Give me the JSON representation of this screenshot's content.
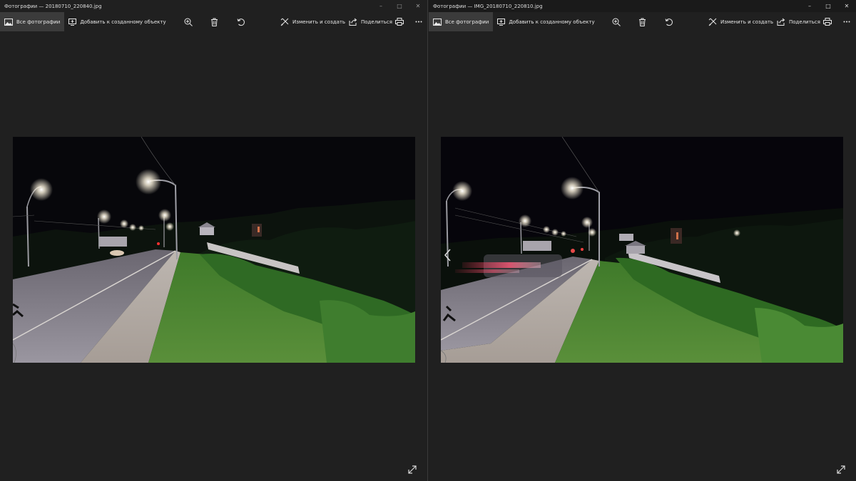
{
  "windows": [
    {
      "title": "Фотографии — 20180710_220840.jpg",
      "toolbar": {
        "all_photos": "Все фотографии",
        "add_to_creation": "Добавить к созданному объекту",
        "edit_create": "Изменить и создать",
        "share": "Поделиться"
      }
    },
    {
      "title": "Фотографии — IMG_20180710_220810.jpg",
      "toolbar": {
        "all_photos": "Все фотографии",
        "add_to_creation": "Добавить к созданному объекту",
        "edit_create": "Изменить и создать",
        "share": "Поделиться"
      }
    }
  ],
  "icons": {
    "minimize": "minimize-icon",
    "maximize": "maximize-icon",
    "close": "close-icon",
    "photos": "photos-icon",
    "add": "add-to-creation-icon",
    "zoom": "zoom-in-icon",
    "delete": "trash-icon",
    "rotate": "rotate-icon",
    "edit": "edit-create-icon",
    "share": "share-icon",
    "print": "print-icon",
    "more": "more-icon",
    "expand": "expand-icon",
    "prev": "chevron-left-icon"
  },
  "colors": {
    "background": "#202020",
    "active_tab": "#3b3b3b",
    "text": "#e8e8e8"
  }
}
